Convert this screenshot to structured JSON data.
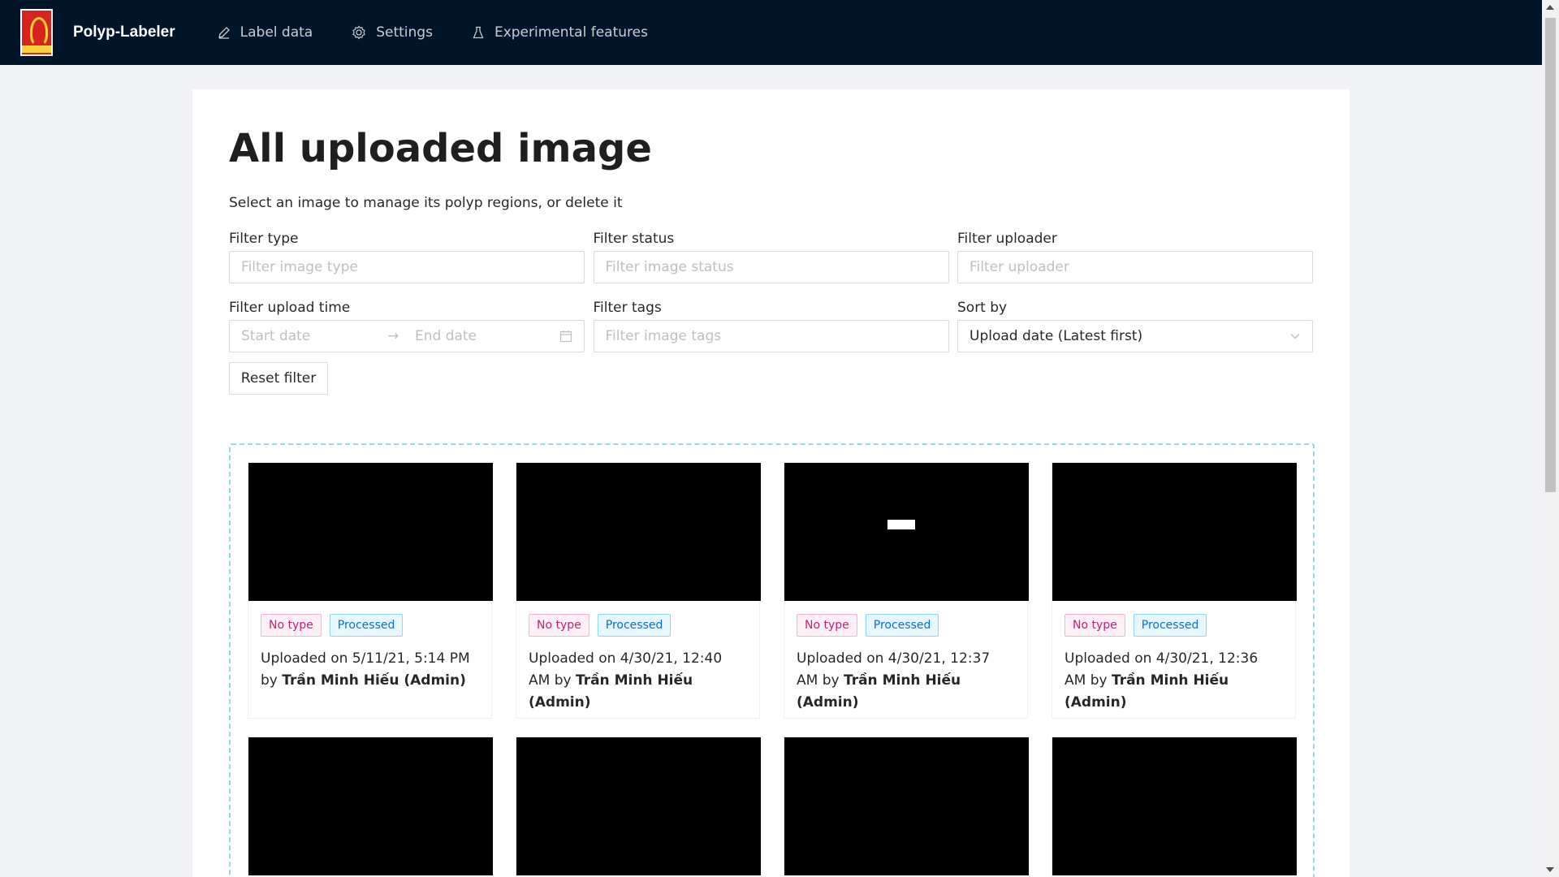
{
  "app": {
    "brand": "Polyp-Labeler",
    "nav": [
      {
        "label": "Label data",
        "icon": "edit-icon"
      },
      {
        "label": "Settings",
        "icon": "gear-icon"
      },
      {
        "label": "Experimental features",
        "icon": "flask-icon"
      }
    ]
  },
  "page": {
    "title": "All uploaded image",
    "subtitle": "Select an image to manage its polyp regions, or delete it"
  },
  "filters": {
    "type": {
      "label": "Filter type",
      "placeholder": "Filter image type"
    },
    "status": {
      "label": "Filter status",
      "placeholder": "Filter image status"
    },
    "uploader": {
      "label": "Filter uploader",
      "placeholder": "Filter uploader"
    },
    "upload_time": {
      "label": "Filter upload time",
      "start_placeholder": "Start date",
      "end_placeholder": "End date"
    },
    "tags": {
      "label": "Filter tags",
      "placeholder": "Filter image tags"
    },
    "sort": {
      "label": "Sort by",
      "value": "Upload date (Latest first)"
    },
    "reset_label": "Reset filter"
  },
  "images": [
    {
      "type_tag": "No type",
      "status_tag": "Processed",
      "uploaded_prefix": "Uploaded on 5/11/21, 5:14 PM by",
      "uploader": "Trần Minh Hiếu (Admin)"
    },
    {
      "type_tag": "No type",
      "status_tag": "Processed",
      "uploaded_prefix": "Uploaded on 4/30/21, 12:40 AM by",
      "uploader": "Trần Minh Hiếu (Admin)"
    },
    {
      "type_tag": "No type",
      "status_tag": "Processed",
      "uploaded_prefix": "Uploaded on 4/30/21, 12:37 AM by",
      "uploader": "Trần Minh Hiếu (Admin)"
    },
    {
      "type_tag": "No type",
      "status_tag": "Processed",
      "uploaded_prefix": "Uploaded on 4/30/21, 12:36 AM by",
      "uploader": "Trần Minh Hiếu (Admin)"
    }
  ],
  "colors": {
    "header_bg": "#001529",
    "gallery_border": "#8fdbe8",
    "tag_no_type": "#c41d7f",
    "tag_processed": "#096dd9"
  }
}
